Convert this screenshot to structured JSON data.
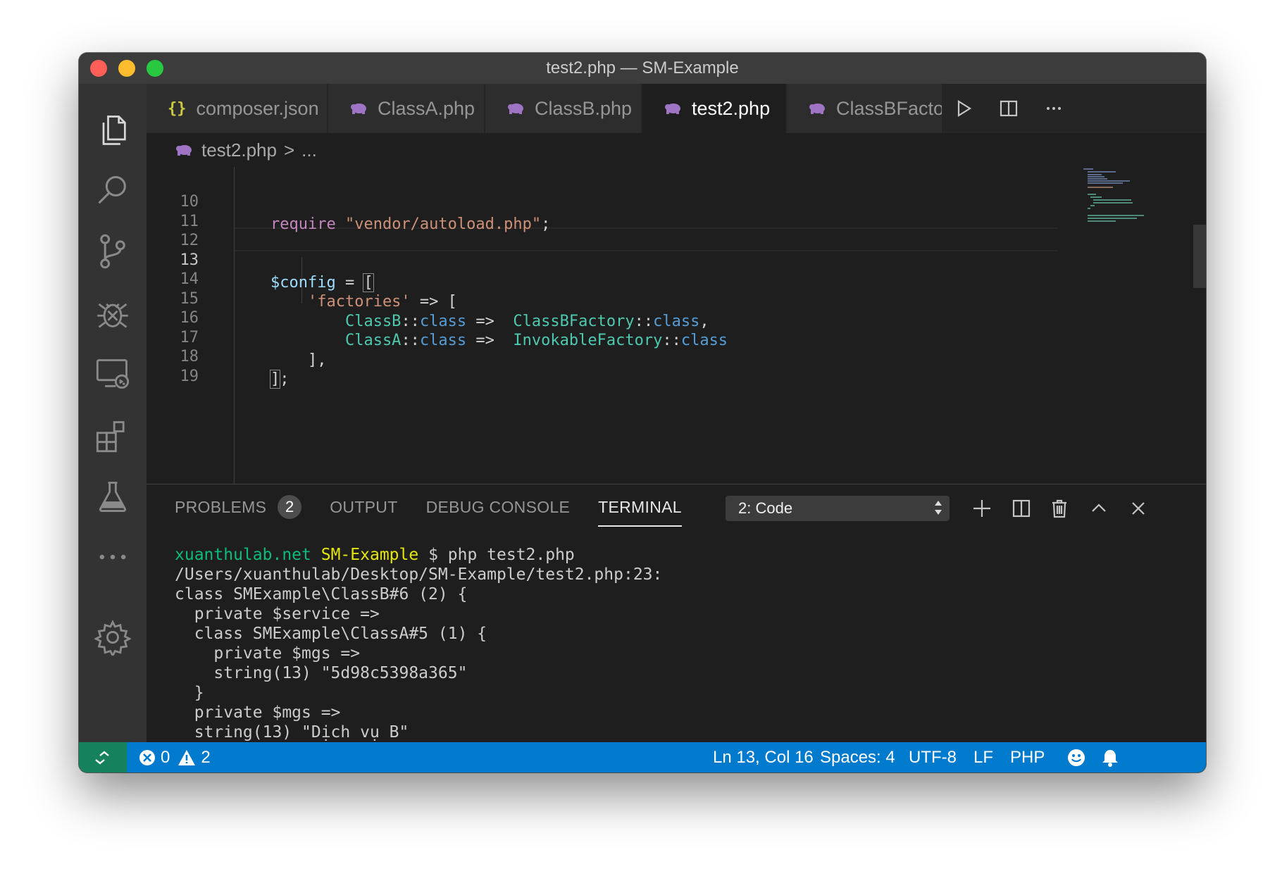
{
  "window": {
    "title": "test2.php — SM-Example"
  },
  "colors": {
    "accent": "#007acc",
    "remote": "#16825d",
    "editor_bg": "#1e1e1e"
  },
  "tabs": [
    {
      "icon": "json-icon",
      "label": "composer.json",
      "active": false
    },
    {
      "icon": "php-icon",
      "label": "ClassA.php",
      "active": false
    },
    {
      "icon": "php-icon",
      "label": "ClassB.php",
      "active": false
    },
    {
      "icon": "php-icon",
      "label": "test2.php",
      "active": true
    },
    {
      "icon": "php-icon",
      "label": "ClassBFactory.",
      "active": false
    }
  ],
  "tab_icons": {
    "json": "{}"
  },
  "tab_close": "✕",
  "breadcrumb": {
    "file": "test2.php",
    "separator": ">",
    "more": "..."
  },
  "code": {
    "lines": [
      {
        "n": "10",
        "p1": "require",
        "p2": " \"vendor/autoload.php\"",
        "p3": ";"
      },
      {
        "n": "11"
      },
      {
        "n": "12"
      },
      {
        "n": "13",
        "p1": "$config",
        "p2": " = ",
        "p3": "["
      },
      {
        "n": "14",
        "p1": "    'factories'",
        "p2": " => ["
      },
      {
        "n": "15",
        "p1": "        ClassB",
        "p2": "::",
        "p3": "class",
        "p4": " =>  ",
        "p5": "ClassBFactory",
        "p6": "::",
        "p7": "class",
        "p8": ","
      },
      {
        "n": "16",
        "p1": "        ClassA",
        "p2": "::",
        "p3": "class",
        "p4": " =>  ",
        "p5": "InvokableFactory",
        "p6": "::",
        "p7": "class"
      },
      {
        "n": "17",
        "p1": "    ],",
        "p2": "",
        "p3": ""
      },
      {
        "n": "18",
        "p1": "]",
        "p2": ";"
      },
      {
        "n": "19"
      }
    ]
  },
  "panel": {
    "tabs": [
      {
        "label": "PROBLEMS",
        "badge": "2"
      },
      {
        "label": "OUTPUT"
      },
      {
        "label": "DEBUG CONSOLE"
      },
      {
        "label": "TERMINAL",
        "active": true
      }
    ],
    "terminal_select": "2: Code"
  },
  "terminal": {
    "host": "xuanthulab.net",
    "project": "SM-Example",
    "prompt": " $ ",
    "command": "php test2.php",
    "lines": [
      "/Users/xuanthulab/Desktop/SM-Example/test2.php:23:",
      "class SMExample\\ClassB#6 (2) {",
      "  private $service =>",
      "  class SMExample\\ClassA#5 (1) {",
      "    private $mgs =>",
      "    string(13) \"5d98c5398a365\"",
      "  }",
      "  private $mgs =>",
      "  string(13) \"Dịch vụ B\"",
      "}"
    ]
  },
  "status": {
    "errors": "0",
    "warnings": "2",
    "position": "Ln 13, Col 16",
    "spaces": "Spaces: 4",
    "encoding": "UTF-8",
    "eol": "LF",
    "language": "PHP"
  }
}
